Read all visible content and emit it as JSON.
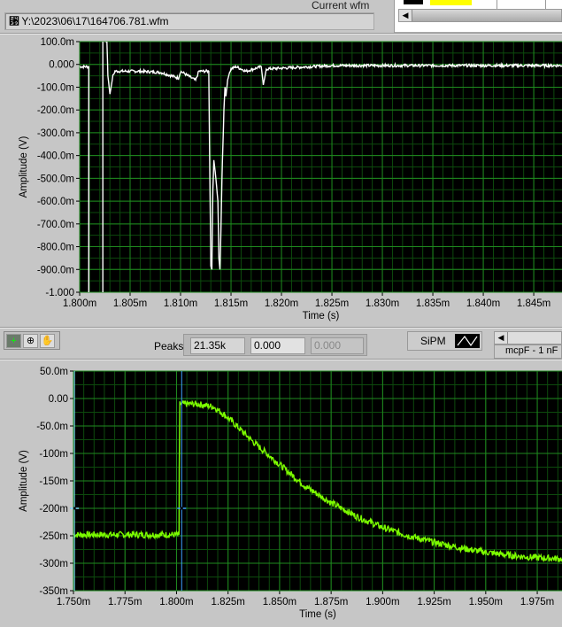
{
  "header": {
    "file_path": "Y:\\2023\\06\\17\\164706.781.wfm",
    "current_wfm_label": "Current wfm"
  },
  "toolbar": {
    "peaks_label": "Peaks",
    "peaks_value": "21.35k",
    "field2": "0.000",
    "field3": "0.000",
    "sipm_label": "SiPM",
    "legend_label": "mcpF - 1 nF"
  },
  "colors": {
    "plot_bg": "#000000",
    "grid_major": "#1f8a1f",
    "grid_minor": "#0d4a0d",
    "trace_top": "#ffffff",
    "trace_bottom": "#7cfc00",
    "cursor1": "#7fdfff",
    "cursor2": "#3fa0ff"
  },
  "chart_data": [
    {
      "type": "line",
      "xlabel": "Time (s)",
      "ylabel": "Amplitude (V)",
      "xlim": [
        1.8,
        1.8478
      ],
      "ylim": [
        -1.0,
        0.1
      ],
      "grid": true,
      "xticks": [
        "1.800m",
        "1.805m",
        "1.810m",
        "1.815m",
        "1.820m",
        "1.825m",
        "1.830m",
        "1.835m",
        "1.840m",
        "1.845m"
      ],
      "yticks": [
        "100.0m",
        "0.000",
        "-100.0m",
        "-200.0m",
        "-300.0m",
        "-400.0m",
        "-500.0m",
        "-600.0m",
        "-700.0m",
        "-800.0m",
        "-900.0m",
        "-1.000"
      ],
      "x": [
        1.8,
        1.8009,
        1.8009,
        1.8023,
        1.8023,
        1.8027,
        1.8028,
        1.803,
        1.8033,
        1.8035,
        1.806,
        1.808,
        1.8098,
        1.81,
        1.8115,
        1.8118,
        1.8128,
        1.8129,
        1.813,
        1.8131,
        1.8132,
        1.8133,
        1.8135,
        1.8137,
        1.8138,
        1.8139,
        1.814,
        1.8141,
        1.8142,
        1.8143,
        1.8144,
        1.8145,
        1.8146,
        1.8148,
        1.815,
        1.8155,
        1.8165,
        1.818,
        1.8182,
        1.8185,
        1.825,
        1.835,
        1.8478
      ],
      "y": [
        -0.01,
        -0.01,
        -1.1,
        -1.1,
        0.12,
        0.1,
        -0.05,
        -0.13,
        -0.05,
        -0.03,
        -0.03,
        -0.035,
        -0.06,
        -0.03,
        -0.07,
        -0.03,
        -0.03,
        -0.5,
        -0.88,
        -0.9,
        -0.55,
        -0.42,
        -0.5,
        -0.6,
        -0.85,
        -0.9,
        -0.73,
        -0.5,
        -0.35,
        -0.2,
        -0.1,
        -0.14,
        -0.09,
        -0.04,
        -0.02,
        -0.01,
        -0.03,
        -0.01,
        -0.09,
        -0.02,
        -0.005,
        -0.005,
        -0.005
      ]
    },
    {
      "type": "line",
      "xlabel": "Time (s)",
      "ylabel": "Amplitude (V)",
      "xlim": [
        1.75,
        1.987
      ],
      "ylim": [
        -0.35,
        0.05
      ],
      "grid": true,
      "xticks": [
        "1.750m",
        "1.775m",
        "1.800m",
        "1.825m",
        "1.850m",
        "1.875m",
        "1.900m",
        "1.925m",
        "1.950m",
        "1.975m"
      ],
      "yticks": [
        "50.0m",
        "0.00",
        "-50.0m",
        "-100m",
        "-150m",
        "-200m",
        "-250m",
        "-300m",
        "-350m"
      ],
      "x": [
        1.75,
        1.8012,
        1.8013,
        1.8016,
        1.81,
        1.818,
        1.825,
        1.8375,
        1.85,
        1.8625,
        1.875,
        1.8875,
        1.9,
        1.9125,
        1.925,
        1.9375,
        1.95,
        1.9625,
        1.975,
        1.987
      ],
      "y": [
        -0.248,
        -0.248,
        -0.13,
        -0.01,
        -0.01,
        -0.015,
        -0.035,
        -0.08,
        -0.12,
        -0.16,
        -0.19,
        -0.215,
        -0.235,
        -0.25,
        -0.262,
        -0.272,
        -0.28,
        -0.286,
        -0.29,
        -0.292
      ],
      "cursors": [
        {
          "x": 1.7505,
          "y": -0.2
        },
        {
          "x": 1.8025,
          "y": -0.2
        }
      ]
    }
  ]
}
